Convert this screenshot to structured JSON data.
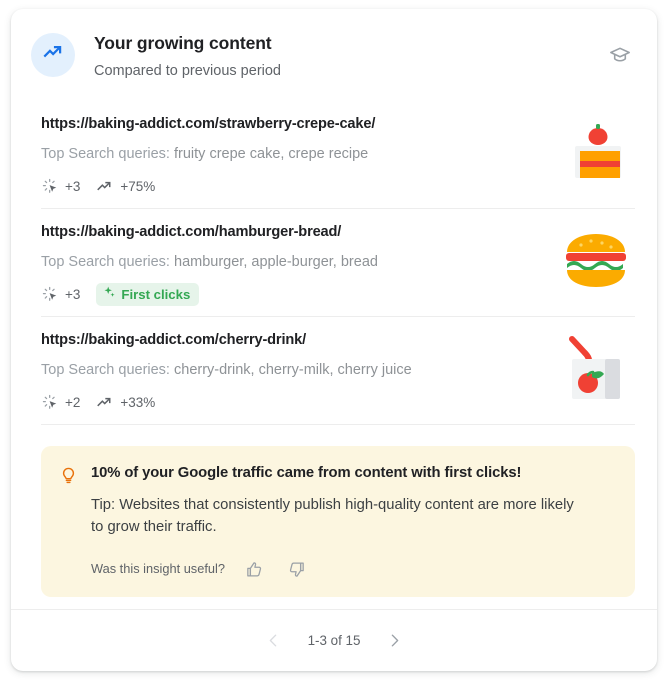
{
  "card": {
    "header": {
      "icon": "trending-up-icon",
      "title": "Your growing content",
      "subtitle": "Compared to previous period",
      "action_icon": "graduation-cap-icon"
    },
    "items": [
      {
        "url": "https://baking-addict.com/strawberry-crepe-cake/",
        "queries_label": "Top Search queries:",
        "queries_value": "fruity crepe cake, crepe recipe",
        "clicks_icon": "ads-click-icon",
        "clicks_value": "+3",
        "trend_icon": "trending-up-icon",
        "trend_value": "+75%",
        "badge": null,
        "thumbnail": "cake-slice-image"
      },
      {
        "url": "https://baking-addict.com/hamburger-bread/",
        "queries_label": "Top Search queries:",
        "queries_value": "hamburger, apple-burger, bread",
        "clicks_icon": "ads-click-icon",
        "clicks_value": "+3",
        "trend_icon": null,
        "trend_value": null,
        "badge": {
          "icon": "sparkle-icon",
          "label": "First clicks"
        },
        "thumbnail": "hamburger-image"
      },
      {
        "url": "https://baking-addict.com/cherry-drink/",
        "queries_label": "Top Search queries:",
        "queries_value": "cherry-drink, cherry-milk, cherry juice",
        "clicks_icon": "ads-click-icon",
        "clicks_value": "+2",
        "trend_icon": "trending-up-icon",
        "trend_value": "+33%",
        "badge": null,
        "thumbnail": "juice-box-image"
      }
    ],
    "insight": {
      "icon": "lightbulb-icon",
      "headline": "10% of your Google traffic came from content with first clicks!",
      "tip": "Tip: Websites that consistently publish high-quality content are more likely to grow their traffic.",
      "feedback_question": "Was this insight useful?",
      "thumb_up_icon": "thumb-up-icon",
      "thumb_down_icon": "thumb-down-icon"
    },
    "footer": {
      "prev_icon": "chevron-left-icon",
      "range_label": "1-3 of 15",
      "next_icon": "chevron-right-icon"
    }
  },
  "colors": {
    "accent_blue": "#1a73e8",
    "avatar_bg": "#e3f0fd",
    "badge_green": "#34a853",
    "badge_bg": "#e6f4ea",
    "insight_bg": "#fcf6e0",
    "lightbulb_orange": "#e8710a",
    "text_primary": "#202124",
    "text_secondary": "#5f6368",
    "text_muted": "#9aa0a6",
    "divider": "#ededed"
  }
}
